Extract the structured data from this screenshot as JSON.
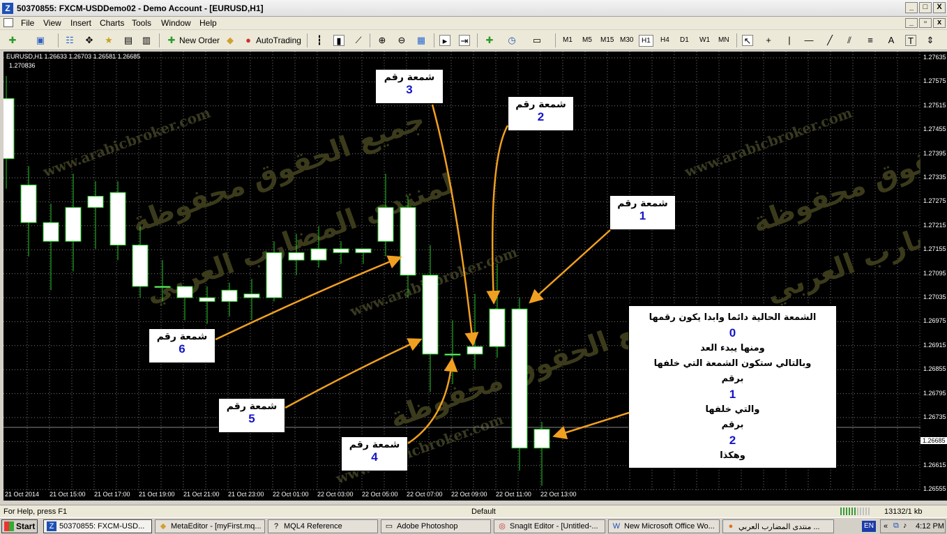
{
  "window": {
    "title": "50370855: FXCM-USDDemo02 - Demo Account - [EURUSD,H1]",
    "app_icon": "Z",
    "controls": [
      "_",
      "□",
      "X"
    ],
    "child_controls": [
      "_",
      "▫",
      "x"
    ]
  },
  "menu": [
    "File",
    "View",
    "Insert",
    "Charts",
    "Tools",
    "Window",
    "Help"
  ],
  "toolbar": {
    "new_order": "New Order",
    "autotrading": "AutoTrading",
    "timeframes": [
      "M1",
      "M5",
      "M15",
      "M30",
      "H1",
      "H4",
      "D1",
      "W1",
      "MN"
    ],
    "active_timeframe": "H1"
  },
  "chart": {
    "symbol_info": "EURUSD,H1  1.26633 1.26703 1.26581 1.26685",
    "top_price_label": "1.270836",
    "current_price": "1.26685",
    "price_labels": [
      "1.27635",
      "1.27575",
      "1.27515",
      "1.27455",
      "1.27395",
      "1.27335",
      "1.27275",
      "1.27215",
      "1.27155",
      "1.27095",
      "1.27035",
      "1.26975",
      "1.26915",
      "1.26855",
      "1.26795",
      "1.26735",
      "1.26685",
      "1.26615",
      "1.26555"
    ],
    "time_labels": [
      "21 Oct 2014",
      "21 Oct 15:00",
      "21 Oct 17:00",
      "21 Oct 19:00",
      "21 Oct 21:00",
      "21 Oct 23:00",
      "22 Oct 01:00",
      "22 Oct 03:00",
      "22 Oct 05:00",
      "22 Oct 07:00",
      "22 Oct 09:00",
      "22 Oct 11:00",
      "22 Oct 13:00"
    ],
    "watermark": [
      "www.arabicbroker.com",
      "جميع الحقوق محفوظة",
      "لمنتدى المضارب العربي"
    ],
    "colors": {
      "background": "#000000",
      "grid": "#7a7a7a",
      "bull_candle": "#ffffff",
      "bear_candle": "#ffffff",
      "wick": "#22cc22",
      "arrow": "#f0a020"
    }
  },
  "chart_data": {
    "type": "candlestick",
    "title": "EURUSD,H1",
    "xlabel": "",
    "ylabel": "",
    "ylim": [
      1.2652,
      1.2767
    ],
    "candles": [
      {
        "o": 1.274,
        "h": 1.2762,
        "l": 1.2732,
        "c": 1.2756
      },
      {
        "o": 1.2733,
        "h": 1.2738,
        "l": 1.2714,
        "c": 1.2723
      },
      {
        "o": 1.2723,
        "h": 1.2728,
        "l": 1.2705,
        "c": 1.2718
      },
      {
        "o": 1.2718,
        "h": 1.2736,
        "l": 1.271,
        "c": 1.2727
      },
      {
        "o": 1.2727,
        "h": 1.2734,
        "l": 1.2716,
        "c": 1.273
      },
      {
        "o": 1.2731,
        "h": 1.2734,
        "l": 1.2713,
        "c": 1.2717
      },
      {
        "o": 1.2717,
        "h": 1.2722,
        "l": 1.2703,
        "c": 1.2706
      },
      {
        "o": 1.2706,
        "h": 1.2713,
        "l": 1.2702,
        "c": 1.2706
      },
      {
        "o": 1.2703,
        "h": 1.2706,
        "l": 1.2697,
        "c": 1.2706
      },
      {
        "o": 1.2703,
        "h": 1.2706,
        "l": 1.2696,
        "c": 1.2702
      },
      {
        "o": 1.2702,
        "h": 1.2707,
        "l": 1.2698,
        "c": 1.2705
      },
      {
        "o": 1.2703,
        "h": 1.2708,
        "l": 1.2697,
        "c": 1.2704
      },
      {
        "o": 1.2703,
        "h": 1.2718,
        "l": 1.2702,
        "c": 1.2715
      },
      {
        "o": 1.2715,
        "h": 1.272,
        "l": 1.2709,
        "c": 1.2713
      },
      {
        "o": 1.2713,
        "h": 1.2722,
        "l": 1.2711,
        "c": 1.2716
      },
      {
        "o": 1.2715,
        "h": 1.2718,
        "l": 1.2712,
        "c": 1.2716
      },
      {
        "o": 1.2715,
        "h": 1.2716,
        "l": 1.2712,
        "c": 1.2716
      },
      {
        "o": 1.2718,
        "h": 1.2736,
        "l": 1.2714,
        "c": 1.2727
      },
      {
        "o": 1.2727,
        "h": 1.273,
        "l": 1.2703,
        "c": 1.2709
      },
      {
        "o": 1.2709,
        "h": 1.2717,
        "l": 1.2678,
        "c": 1.2688
      },
      {
        "o": 1.2688,
        "h": 1.2697,
        "l": 1.268,
        "c": 1.2688
      },
      {
        "o": 1.2688,
        "h": 1.2704,
        "l": 1.2684,
        "c": 1.269
      },
      {
        "o": 1.269,
        "h": 1.2712,
        "l": 1.2687,
        "c": 1.27
      },
      {
        "o": 1.27,
        "h": 1.2703,
        "l": 1.2657,
        "c": 1.2663
      },
      {
        "o": 1.2663,
        "h": 1.267,
        "l": 1.2653,
        "c": 1.2668
      }
    ]
  },
  "callouts": [
    {
      "label": "شمعة رقم",
      "number": "3"
    },
    {
      "label": "شمعة رقم",
      "number": "2"
    },
    {
      "label": "شمعة رقم",
      "number": "1"
    },
    {
      "label": "شمعة رقم",
      "number": "6"
    },
    {
      "label": "شمعة رقم",
      "number": "5"
    },
    {
      "label": "شمعة رقم",
      "number": "4"
    }
  ],
  "explanation": {
    "line1": "الشمعة الحالية دائما وابدا يكون رقمها",
    "num1": "0",
    "line2": "ومنها يبدء العد",
    "line3": "وبالتالي ستكون الشمعة التي خلفها",
    "line4": "برقم",
    "num2": "1",
    "line5": "والتي خلفها",
    "line6": "برقم",
    "num3": "2",
    "line7": "وهكذا"
  },
  "status": {
    "help": "For Help, press F1",
    "profile": "Default",
    "traffic": "13132/1 kb"
  },
  "taskbar": {
    "start": "Start",
    "tasks": [
      "50370855: FXCM-USD...",
      "MetaEditor - [myFirst.mq...",
      "MQL4 Reference",
      "Adobe Photoshop",
      "SnagIt Editor - [Untitled-...",
      "New Microsoft Office Wo...",
      "منتدى المضارب العربي ..."
    ],
    "lang": "EN",
    "time": "4:12 PM"
  }
}
